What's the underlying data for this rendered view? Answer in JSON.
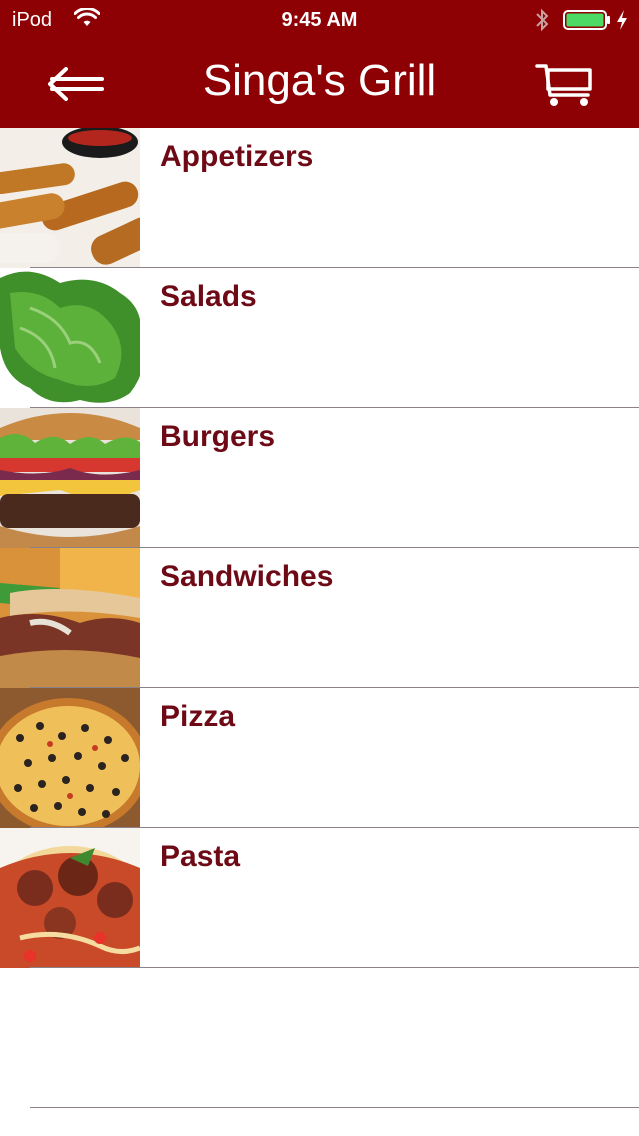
{
  "status_bar": {
    "carrier": "iPod",
    "time": "9:45 AM",
    "icons": [
      "wifi-icon",
      "bluetooth-icon",
      "battery-icon",
      "charging-icon"
    ]
  },
  "nav": {
    "title": "Singa's Grill",
    "back_icon": "back-arrow-icon",
    "cart_icon": "shopping-cart-icon",
    "bar_color": "#8d0004"
  },
  "menu": {
    "items": [
      {
        "label": "Appetizers",
        "image": "appetizers-photo"
      },
      {
        "label": "Salads",
        "image": "salads-photo"
      },
      {
        "label": "Burgers",
        "image": "burgers-photo"
      },
      {
        "label": "Sandwiches",
        "image": "sandwiches-photo"
      },
      {
        "label": "Pizza",
        "image": "pizza-photo"
      },
      {
        "label": "Pasta",
        "image": "pasta-photo"
      }
    ],
    "label_color": "#6e0a16"
  }
}
